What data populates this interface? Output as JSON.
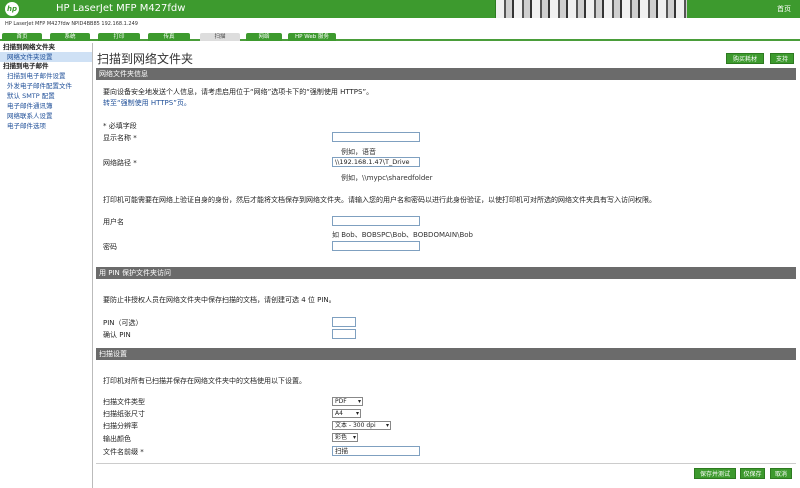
{
  "header": {
    "logo": "hp",
    "app_title": "HP LaserJet MFP M427fdw",
    "home_link": "首页",
    "device_info": "HP LaserJet MFP M427fdw    NPID4BB85   192.168.1.249"
  },
  "tabs": [
    {
      "label": "首页"
    },
    {
      "label": "系统"
    },
    {
      "label": "打印"
    },
    {
      "label": "传真"
    },
    {
      "label": "扫描"
    },
    {
      "label": "网络"
    },
    {
      "label": "HP Web 服务"
    }
  ],
  "sidebar": {
    "heading1": "扫描到网络文件夹",
    "item_network_folder_settings": "网络文件夹设置",
    "heading2": "扫描到电子邮件",
    "item_email_settings": "扫描到电子邮件设置",
    "item_outgoing_profiles": "外发电子邮件配置文件",
    "item_smtp": "默认 SMTP 配置",
    "item_address_book": "电子邮件通讯簿",
    "item_network_contacts": "网络联系人设置",
    "item_email_options": "电子邮件选项"
  },
  "page": {
    "title": "扫描到网络文件夹",
    "buy_supplies": "购买耗材",
    "support": "支持"
  },
  "section1": {
    "title": "网络文件夹信息",
    "intro": "要向设备安全地发送个人信息，请考虑启用位于“网络”选项卡下的“强制使用 HTTPS”。",
    "https_link": "转至“强制使用 HTTPS”页。",
    "required_note": "* 必填字段",
    "display_name_label": "显示名称 *",
    "display_name_value": "",
    "display_name_hint": "例如，语音",
    "network_path_label": "网络路径 *",
    "network_path_value": "\\\\192.168.1.47\\T_Drive",
    "network_path_hint": "例如，\\\\mypc\\sharedfolder",
    "auth_note": "打印机可能需要在网络上验证自身的身份，然后才能将文档保存到网络文件夹。请输入您的用户名和密码以进行此身份验证，以使打印机可对所选的网络文件夹具有写入访问权限。",
    "username_label": "用户名",
    "username_value": "",
    "username_hint": "如 Bob、BOBSPC\\Bob、BOBDOMAIN\\Bob",
    "password_label": "密码",
    "password_value": ""
  },
  "section2": {
    "title": "用 PIN 保护文件夹访问",
    "intro": "要防止非授权人员在网络文件夹中保存扫描的文档，请创建可选 4 位 PIN。",
    "pin_label": "PIN（可选）",
    "pin_value": "",
    "confirm_pin_label": "确认 PIN",
    "confirm_pin_value": ""
  },
  "section3": {
    "title": "扫描设置",
    "intro": "打印机对所有已扫描并保存在网络文件夹中的文档使用以下设置。",
    "file_type_label": "扫描文件类型",
    "file_type_value": "PDF",
    "paper_size_label": "扫描纸张尺寸",
    "paper_size_value": "A4",
    "resolution_label": "扫描分辨率",
    "resolution_value": "文本 - 300 dpi",
    "color_label": "输出颜色",
    "color_value": "彩色",
    "prefix_label": "文件名前缀 *",
    "prefix_value": "扫描"
  },
  "footer": {
    "save_test": "保存并测试",
    "save_only": "仅保存",
    "cancel": "取消"
  }
}
